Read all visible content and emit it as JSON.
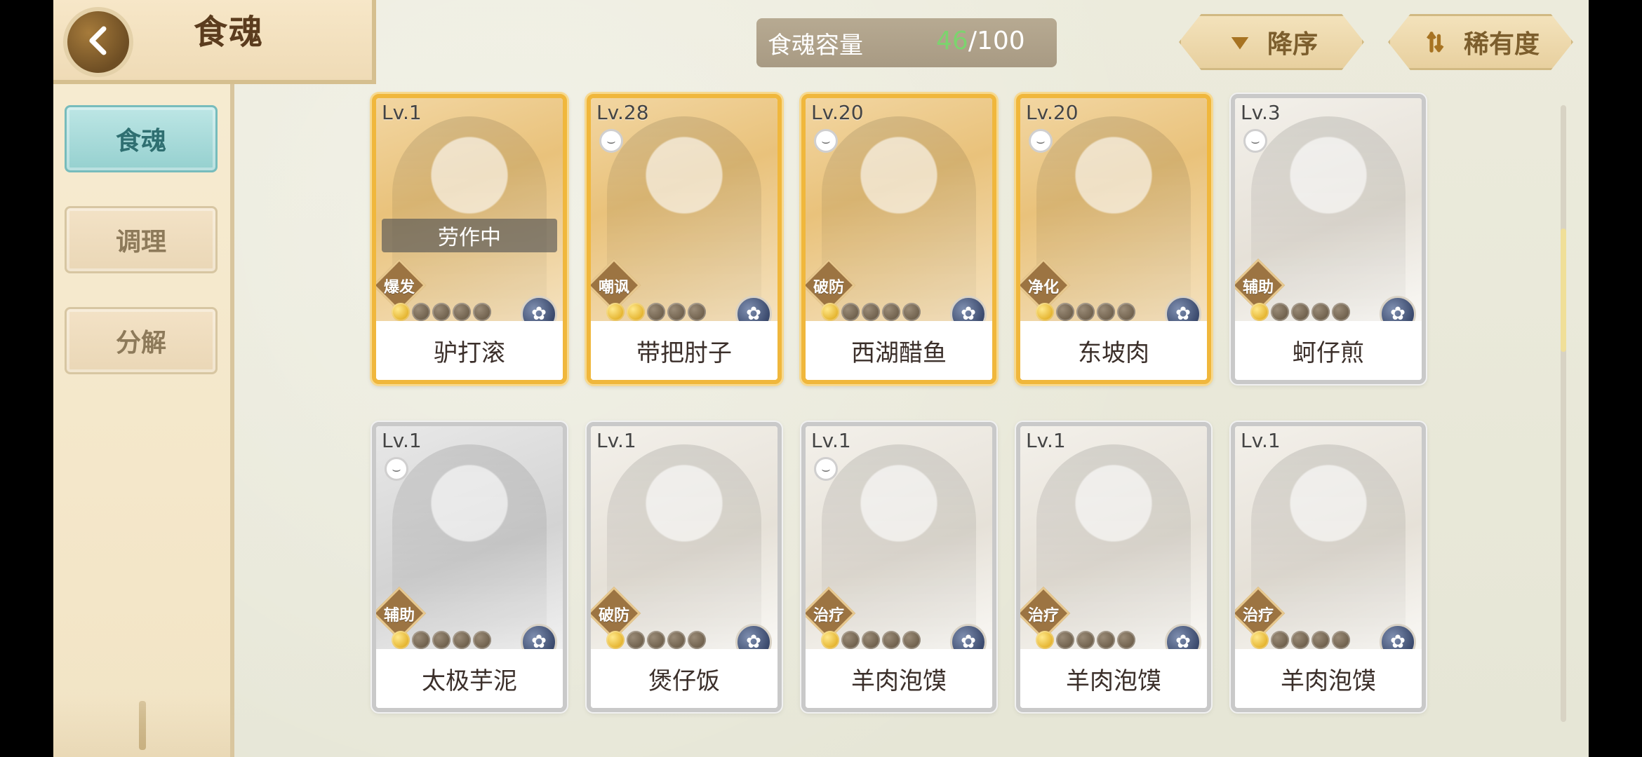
{
  "header": {
    "title": "食魂",
    "capacity_label": "食魂容量",
    "capacity_current": "46",
    "capacity_max": "/100",
    "sort_desc_label": "降序",
    "sort_rarity_label": "稀有度"
  },
  "sidebar": {
    "items": [
      {
        "label": "食魂"
      },
      {
        "label": "调理"
      },
      {
        "label": "分解"
      }
    ]
  },
  "cards": [
    {
      "level": "Lv.1",
      "name": "驴打滚",
      "role": "爆发",
      "status": "劳作中",
      "stars_on": 1,
      "stars_total": 5
    },
    {
      "level": "Lv.28",
      "name": "带把肘子",
      "role": "嘲讽",
      "stars_on": 2,
      "stars_total": 5
    },
    {
      "level": "Lv.20",
      "name": "西湖醋鱼",
      "role": "破防",
      "stars_on": 1,
      "stars_total": 5
    },
    {
      "level": "Lv.20",
      "name": "东坡肉",
      "role": "净化",
      "stars_on": 1,
      "stars_total": 5
    },
    {
      "level": "Lv.3",
      "name": "蚵仔煎",
      "role": "辅助",
      "stars_on": 1,
      "stars_total": 5
    },
    {
      "level": "Lv.1",
      "name": "太极芋泥",
      "role": "辅助",
      "stars_on": 1,
      "stars_total": 5
    },
    {
      "level": "Lv.1",
      "name": "煲仔饭",
      "role": "破防",
      "stars_on": 1,
      "stars_total": 5
    },
    {
      "level": "Lv.1",
      "name": "羊肉泡馍",
      "role": "治疗",
      "stars_on": 1,
      "stars_total": 5
    },
    {
      "level": "Lv.1",
      "name": "羊肉泡馍",
      "role": "治疗",
      "stars_on": 1,
      "stars_total": 5
    },
    {
      "level": "Lv.1",
      "name": "羊肉泡馍",
      "role": "治疗",
      "stars_on": 1,
      "stars_total": 5
    }
  ],
  "icons": {
    "back": "chevron-left-icon",
    "sort_desc": "triangle-down-icon",
    "sort_rarity": "sort-bars-icon",
    "element": "element-badge-icon",
    "bowl": "bowl-icon"
  },
  "colors": {
    "accent_gold": "#f0b73c",
    "accent_green": "#7cd36e",
    "active_tab": "#95d0cf"
  }
}
